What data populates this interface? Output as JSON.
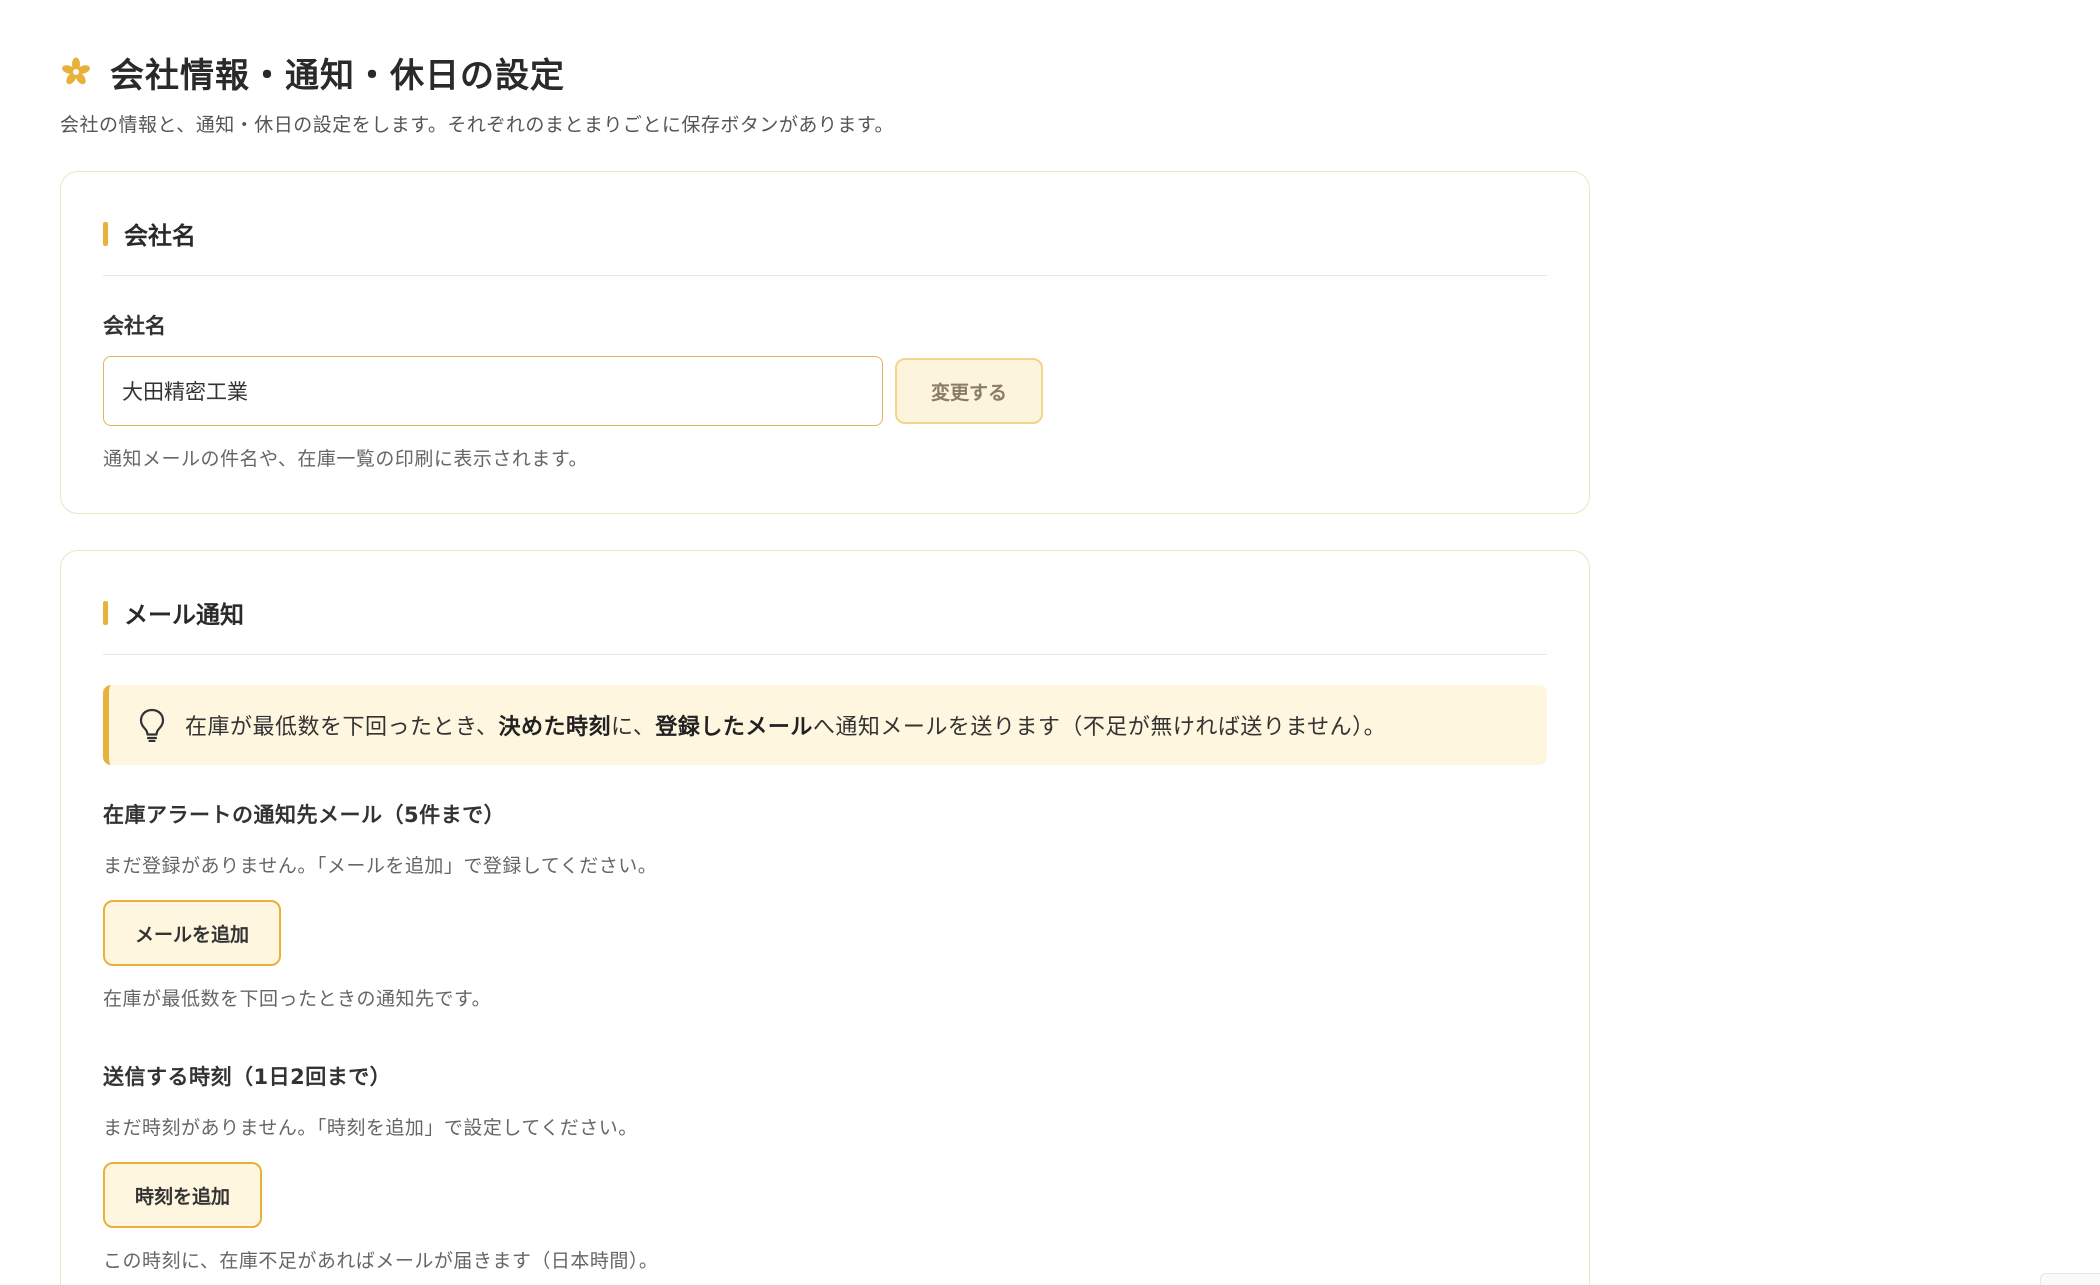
{
  "page": {
    "icon": "flower-icon",
    "title": "会社情報・通知・休日の設定",
    "description": "会社の情報と、通知・休日の設定をします。それぞれのまとまりごとに保存ボタンがあります。"
  },
  "company_card": {
    "title": "会社名",
    "field_label": "会社名",
    "input_value": "大田精密工業",
    "change_button": "変更する",
    "help": "通知メールの件名や、在庫一覧の印刷に表示されます。"
  },
  "mail_card": {
    "title": "メール通知",
    "info": {
      "icon": "lightbulb-icon",
      "part1": "在庫が最低数を下回ったとき、",
      "bold1": "決めた時刻",
      "part2": "に、",
      "bold2": "登録したメール",
      "part3": "へ通知メールを送ります（不足が無ければ送りません）。"
    },
    "recipients": {
      "label": "在庫アラートの通知先メール（5件まで）",
      "empty": "まだ登録がありません。「メールを追加」で登録してください。",
      "add_button": "メールを追加",
      "help": "在庫が最低数を下回ったときの通知先です。"
    },
    "times": {
      "label": "送信する時刻（1日2回まで）",
      "empty": "まだ時刻がありません。「時刻を追加」で設定してください。",
      "add_button": "時刻を追加",
      "help": "この時刻に、在庫不足があればメールが届きます（日本時間）。"
    }
  },
  "colors": {
    "accent": "#e8b13a",
    "info_bg": "#fff6e0",
    "card_border": "#f0e3c2"
  }
}
